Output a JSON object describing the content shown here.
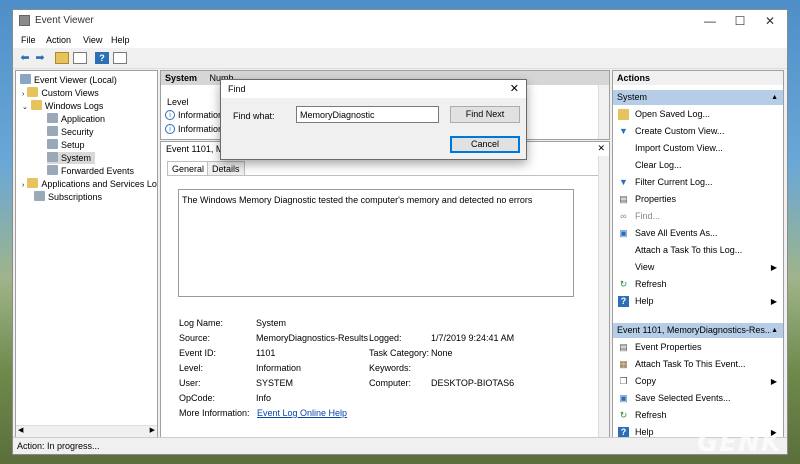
{
  "window": {
    "title": "Event Viewer",
    "controls": {
      "minimize": "—",
      "maximize": "☐",
      "close": "✕"
    }
  },
  "menu": [
    "File",
    "Action",
    "View",
    "Help"
  ],
  "tree": {
    "root": "Event Viewer (Local)",
    "custom_views": "Custom Views",
    "windows_logs": "Windows Logs",
    "logs": [
      "Application",
      "Security",
      "Setup",
      "System",
      "Forwarded Events"
    ],
    "apps_services": "Applications and Services Lo",
    "subscriptions": "Subscriptions"
  },
  "list": {
    "header_system": "System",
    "header_number": "Numb",
    "col_level": "Level",
    "rows": [
      "Information",
      "Information"
    ]
  },
  "event_panel": {
    "title": "Event 1101, Mi",
    "tab_general": "General",
    "tab_details": "Details",
    "message": "The Windows Memory Diagnostic tested the computer's memory and detected no errors",
    "fields": {
      "log_name_label": "Log Name:",
      "log_name": "System",
      "source_label": "Source:",
      "source": "MemoryDiagnostics-Results",
      "logged_label": "Logged:",
      "logged": "1/7/2019 9:24:41 AM",
      "event_id_label": "Event ID:",
      "event_id": "1101",
      "task_category_label": "Task Category:",
      "task_category": "None",
      "level_label": "Level:",
      "level": "Information",
      "keywords_label": "Keywords:",
      "keywords": "",
      "user_label": "User:",
      "user": "SYSTEM",
      "computer_label": "Computer:",
      "computer": "DESKTOP-BIOTAS6",
      "opcode_label": "OpCode:",
      "opcode": "Info",
      "more_info_label": "More Information:",
      "more_info_link": "Event Log Online Help"
    }
  },
  "actions": {
    "title": "Actions",
    "section1": "System",
    "items1": [
      {
        "label": "Open Saved Log...",
        "icon": "folder-icon"
      },
      {
        "label": "Create Custom View...",
        "icon": "filter-icon"
      },
      {
        "label": "Import Custom View...",
        "icon": ""
      },
      {
        "label": "Clear Log...",
        "icon": ""
      },
      {
        "label": "Filter Current Log...",
        "icon": "filter-icon"
      },
      {
        "label": "Properties",
        "icon": "properties-icon"
      },
      {
        "label": "Find...",
        "icon": "binoculars-icon"
      },
      {
        "label": "Save All Events As...",
        "icon": "save-icon"
      },
      {
        "label": "Attach a Task To this Log...",
        "icon": ""
      },
      {
        "label": "View",
        "icon": "",
        "submenu": true
      },
      {
        "label": "Refresh",
        "icon": "refresh-icon"
      },
      {
        "label": "Help",
        "icon": "help-icon",
        "submenu": true
      }
    ],
    "section2": "Event 1101, MemoryDiagnostics-Res...",
    "items2": [
      {
        "label": "Event Properties",
        "icon": "properties-icon"
      },
      {
        "label": "Attach Task To This Event...",
        "icon": "task-icon"
      },
      {
        "label": "Copy",
        "icon": "copy-icon",
        "submenu": true
      },
      {
        "label": "Save Selected Events...",
        "icon": "save-icon"
      },
      {
        "label": "Refresh",
        "icon": "refresh-icon"
      },
      {
        "label": "Help",
        "icon": "help-icon",
        "submenu": true
      }
    ]
  },
  "status": "Action:  In progress...",
  "find_dialog": {
    "title": "Find",
    "label": "Find what:",
    "value": "MemoryDiagnostic",
    "find_next": "Find Next",
    "cancel": "Cancel",
    "close": "✕"
  },
  "watermark": "GENK"
}
